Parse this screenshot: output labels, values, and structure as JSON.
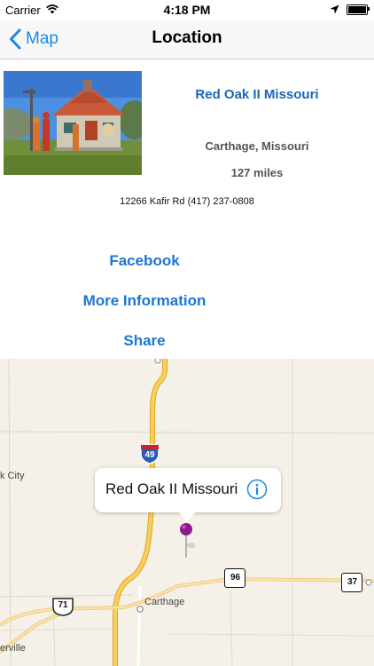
{
  "status_bar": {
    "carrier": "Carrier",
    "time": "4:18 PM",
    "icons": [
      "wifi-icon",
      "location-arrow-icon",
      "battery-icon"
    ]
  },
  "nav": {
    "back_label": "Map",
    "title": "Location"
  },
  "place": {
    "name": "Red Oak II Missouri",
    "city": "Carthage, Missouri",
    "distance": "127 miles",
    "address_line": "12266 Kafir Rd  (417) 237-0808"
  },
  "actions": {
    "facebook": "Facebook",
    "more_info": "More Information",
    "share": "Share"
  },
  "map": {
    "callout_title": "Red Oak II Missouri",
    "labels": {
      "city_left": "k City",
      "carthage": "Carthage",
      "bottom_left": "erville"
    },
    "shields": {
      "interstate": "49",
      "us_route": "71",
      "state_96": "96",
      "state_37": "37"
    },
    "colors": {
      "accent": "#1e88e5",
      "highway": "#f5c242",
      "pin": "#8b1a8b"
    }
  }
}
